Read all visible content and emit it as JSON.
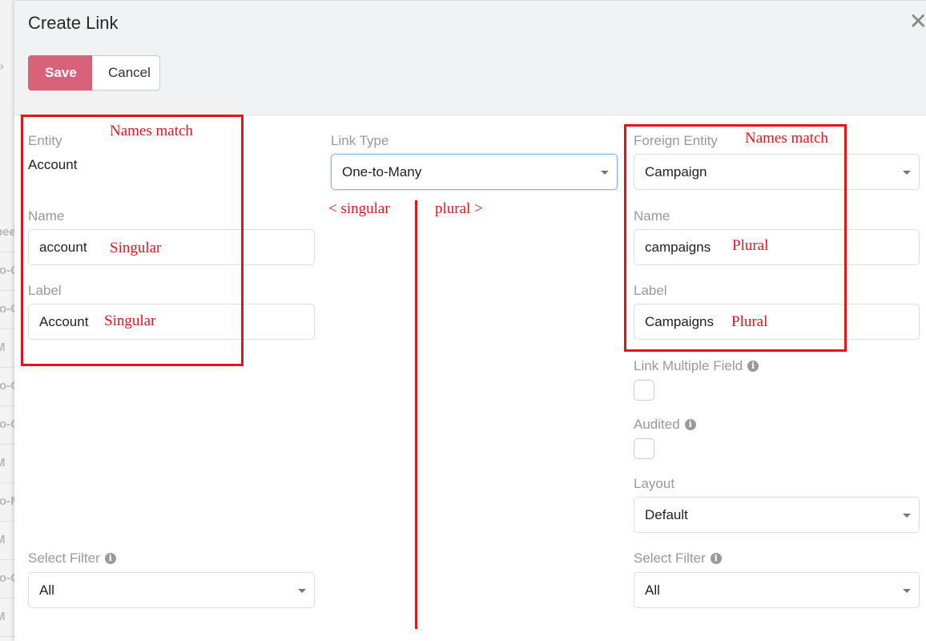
{
  "background_rows": [
    "pee",
    "to-O",
    "to-O",
    "M",
    "to-O",
    "to-O",
    "M",
    "to-M",
    "M",
    "to-O",
    "M"
  ],
  "dialog": {
    "title": "Create Link",
    "save_label": "Save",
    "cancel_label": "Cancel",
    "close_symbol": "✕"
  },
  "left": {
    "entity_label": "Entity",
    "entity_value": "Account",
    "name_label": "Name",
    "name_value": "account",
    "label_label": "Label",
    "label_value": "Account",
    "select_filter_label": "Select Filter",
    "select_filter_value": "All"
  },
  "middle": {
    "link_type_label": "Link Type",
    "link_type_value": "One-to-Many"
  },
  "right": {
    "foreign_entity_label": "Foreign Entity",
    "foreign_entity_value": "Campaign",
    "name_label": "Name",
    "name_value": "campaigns",
    "label_label": "Label",
    "label_value": "Campaigns",
    "link_multiple_label": "Link Multiple Field",
    "audited_label": "Audited",
    "layout_label": "Layout",
    "layout_value": "Default",
    "select_filter_label": "Select Filter",
    "select_filter_value": "All"
  },
  "annotations": {
    "names_match_left": "Names match",
    "names_match_right": "Names match",
    "singular_name": "Singular",
    "singular_label": "Singular",
    "plural_name": "Plural",
    "plural_label": "Plural",
    "singular_arrow": "< singular",
    "plural_arrow": "plural >",
    "color": "#e8131a"
  },
  "colors": {
    "save_button": "#d76279",
    "header_bg": "#f1f2f3"
  },
  "icons": {
    "info": "info-icon",
    "close": "close-icon",
    "caret": "chevron-down-icon"
  }
}
